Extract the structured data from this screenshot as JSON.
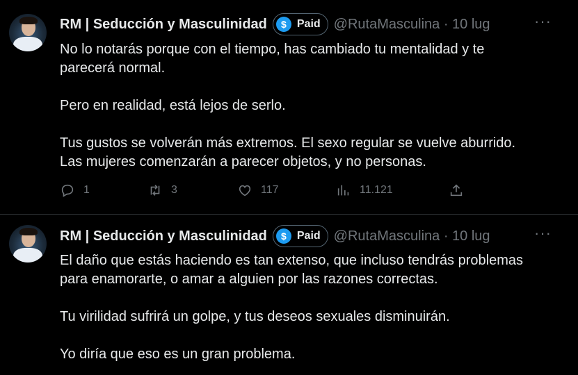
{
  "tweets": [
    {
      "author": "RM | Seducción y Masculinidad",
      "paid_label": "Paid",
      "handle_time": "@RutaMasculina · 10 lug",
      "text": "No lo notarás porque con el tiempo, has cambiado tu mentalidad y te\nparecerá normal.\n\nPero en realidad, está lejos de serlo.\n\nTus gustos se volverán más extremos. El sexo regular se vuelve aburrido.\nLas mujeres comenzarán a parecer objetos, y no personas.",
      "replies": "1",
      "retweets": "3",
      "likes": "117",
      "views": "11.121"
    },
    {
      "author": "RM | Seducción y Masculinidad",
      "paid_label": "Paid",
      "handle_time": "@RutaMasculina · 10 lug",
      "text": "El daño que estás haciendo es tan extenso, que incluso tendrás problemas\npara enamorarte, o amar a alguien por las razones correctas.\n\nTu virilidad sufrirá un golpe, y tus deseos sexuales disminuirán.\n\nYo diría que eso es un gran problema."
    }
  ],
  "more_icon": "···",
  "dollar_icon": "$",
  "colors": {
    "background": "#000000",
    "text": "#e7e9ea",
    "muted": "#71767b",
    "badge": "#1d9bf0",
    "border": "#2f3336"
  },
  "icons": [
    "reply-icon",
    "retweet-icon",
    "like-icon",
    "views-icon",
    "share-icon",
    "more-icon",
    "paid-badge-icon"
  ]
}
